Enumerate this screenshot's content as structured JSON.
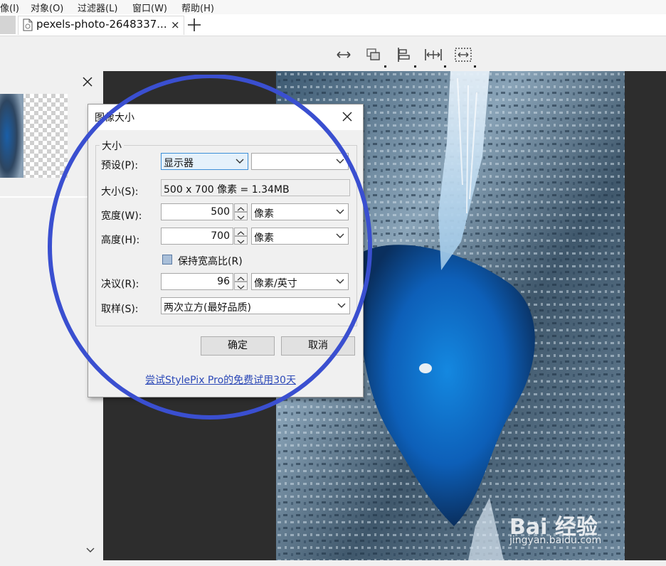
{
  "menu": {
    "items": [
      "像(I)",
      "对象(O)",
      "过滤器(L)",
      "窗口(W)",
      "帮助(H)"
    ]
  },
  "tabs": {
    "document_title": "pexels-photo-2648337...",
    "close_glyph": "×",
    "add_icon": "plus-icon"
  },
  "toolbar": {
    "icons": [
      "flip-horizontal-icon",
      "arrange-layers-icon",
      "align-left-icon",
      "distribute-icon",
      "resize-canvas-icon"
    ]
  },
  "panel": {
    "close_glyph": "×",
    "scroll_down_glyph": "⌄"
  },
  "dialog": {
    "title": "图像大小",
    "close_glyph": "×",
    "group_title": "大小",
    "preset_label": "预设(P):",
    "preset_value": "显示器",
    "preset_second_value": "",
    "size_label": "大小(S):",
    "size_value": "500 x 700 像素 = 1.34MB",
    "width_label": "宽度(W):",
    "width_value": "500",
    "width_unit": "像素",
    "height_label": "高度(H):",
    "height_value": "700",
    "height_unit": "像素",
    "keep_ratio_label": "保持宽高比(R)",
    "resolution_label": "决议(R):",
    "resolution_value": "96",
    "resolution_unit": "像素/英寸",
    "sampling_label": "取样(S):",
    "sampling_value": "两次立方(最好品质)",
    "ok_label": "确定",
    "cancel_label": "取消",
    "promo_link": "尝试StylePix Pro的免费试用30天"
  },
  "watermark": {
    "brand": "Bai 经验",
    "url": "jingyan.baidu.com"
  },
  "colors": {
    "annotation_circle": "#3a4fd0",
    "link": "#2b48b7",
    "canvas": "#2d2d2d"
  }
}
